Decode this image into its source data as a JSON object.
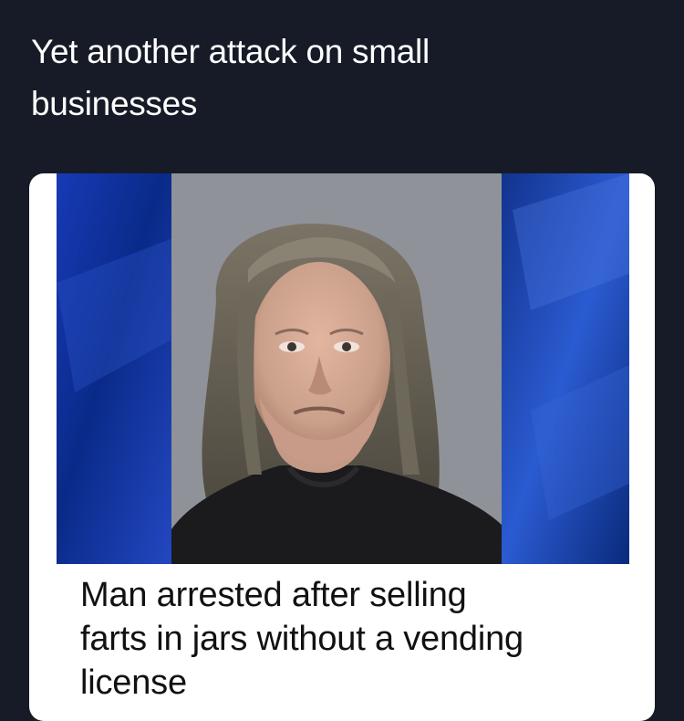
{
  "post": {
    "caption_lines": [
      "Yet another attack on small",
      "businesses"
    ]
  },
  "card": {
    "photo_icon": "mugshot-photo",
    "headline_lines": [
      "Man arrested after selling",
      "farts in jars without a vending",
      "license"
    ]
  },
  "colors": {
    "background": "#171b27",
    "card": "#ffffff",
    "photo_blue": "#0c2a8a",
    "photo_gray": "#8f9298"
  }
}
